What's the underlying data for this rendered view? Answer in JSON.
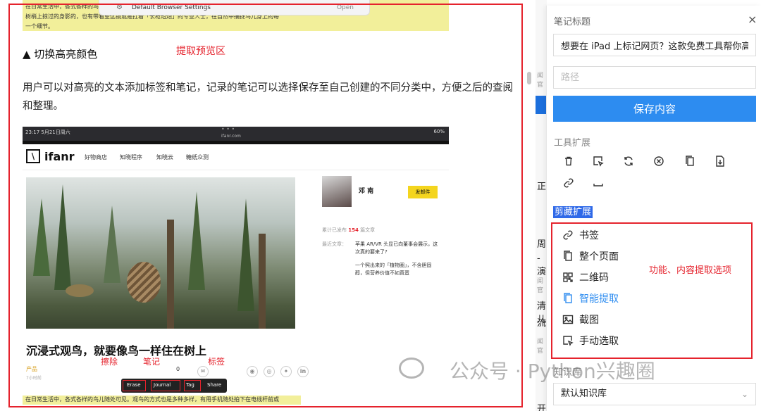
{
  "preview": {
    "top_text_1": "在日常生活中，各式各样的鸟儿",
    "top_text_2": "树梢上掠过的身影的，也有带着望远镜或是扛着「长枪短炮」的专业人士，在自然中捕捉鸟儿身上的每",
    "top_text_3": "一个细节。",
    "popup_title": "Default Browser Settings",
    "popup_open": "Open",
    "section_heading": "▲ 切换高亮颜色",
    "preview_label": "提取预览区",
    "paragraph": "用户可以对高亮的文本添加标签和笔记，记录的笔记可以选择保存至自己创建的不同分类中，方便之后的查阅和整理。",
    "shot": {
      "status_time": "23:17  5月21日周六",
      "status_dots": "• • •",
      "status_url": "ifanr.com",
      "status_battery": "60%",
      "logo": "ifanr",
      "nav": [
        "好物商店",
        "知晓程序",
        "知晓云",
        "糖纸众测"
      ],
      "author": "邓 南",
      "follow": "发邮件",
      "stat_prefix": "累计已发布",
      "stat_count": "154",
      "stat_suffix": "篇文章",
      "recent_label": "最近文章：",
      "rec_1": "苹果 AR/VR 头显已向董事会展示，这次真的要来了?",
      "rec_2": "一个照出来的「植物圈」，不含胆固醇，但营养价值不如真蛋",
      "title": "沉浸式观鸟，就要像鸟一样住在树上",
      "category": "产品",
      "category_sub": "7小时前",
      "comment_count": "0",
      "ann_erase": "擦除",
      "ann_note": "笔记",
      "ann_tag": "标签",
      "ctx": [
        "Erase",
        "Journal",
        "Tag",
        "Share"
      ],
      "bottom_text": "在日常生活中，各式各样的鸟儿随处可见。观鸟的方式也是多种多样，有用手机随处拍下在电线杆前或"
    }
  },
  "strip": {
    "a": "闻官",
    "b": "正",
    "c": "周",
    "d": "-演",
    "e": "闻官",
    "f": "清儿",
    "g": "流",
    "h": "闻官",
    "i": "开"
  },
  "panel": {
    "title_label": "笔记标题",
    "close": "×",
    "title_value": "想要在 iPad 上标记网页？这款免费工具帮你高效阅读",
    "path_placeholder": "路径",
    "save": "保存内容",
    "tools_label": "工具扩展",
    "clip_label": "剪藏扩展",
    "clip_items": [
      "书签",
      "整个页面",
      "二维码",
      "智能提取",
      "截图",
      "手动选取"
    ],
    "extract_label": "功能、内容提取选项",
    "kb_label": "知识库",
    "kb_value": "默认知识库"
  },
  "watermark": "公众号 · Python兴趣圈",
  "colors": {
    "accent": "#2d8cf0",
    "annotation": "#e5232d",
    "highlight": "#f2ef9a"
  }
}
